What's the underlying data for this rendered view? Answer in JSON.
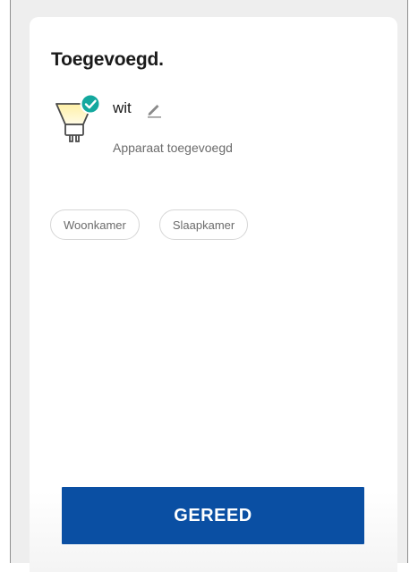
{
  "screen": {
    "title": "Toegevoegd.",
    "device": {
      "name": "wit",
      "status": "Apparaat toegevoegd",
      "icon": "bulb-added-icon",
      "check_color": "#13a89e"
    },
    "rooms": [
      {
        "label": "Woonkamer"
      },
      {
        "label": "Slaapkamer"
      }
    ],
    "done_label": "GEREED",
    "accent_color": "#0a4fa3"
  }
}
